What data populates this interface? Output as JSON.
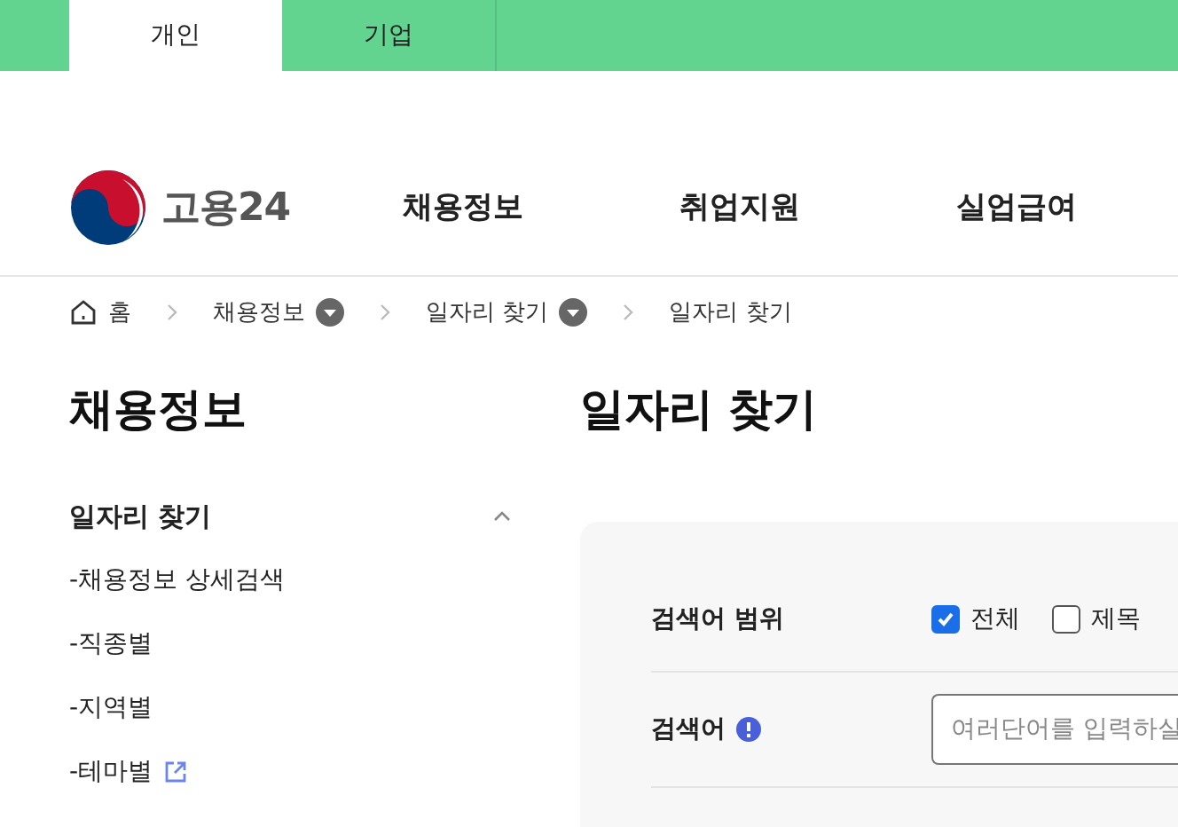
{
  "top_tabs": [
    {
      "label": "개인",
      "selected": true
    },
    {
      "label": "기업",
      "selected": false
    }
  ],
  "logo": {
    "text": "고용24"
  },
  "nav": [
    "채용정보",
    "취업지원",
    "실업급여"
  ],
  "breadcrumb": [
    {
      "label": "홈",
      "kind": "home"
    },
    {
      "label": "채용정보",
      "kind": "dropdown"
    },
    {
      "label": "일자리 찾기",
      "kind": "dropdown"
    },
    {
      "label": "일자리 찾기",
      "kind": "current"
    }
  ],
  "sidebar": {
    "title": "채용정보",
    "section": {
      "label": "일자리 찾기",
      "expanded": true,
      "children": [
        {
          "label": "-채용정보 상세검색",
          "external": false
        },
        {
          "label": "-직종별",
          "external": false
        },
        {
          "label": "-지역별",
          "external": false
        },
        {
          "label": "-테마별",
          "external": true
        }
      ]
    }
  },
  "page_title": "일자리 찾기",
  "search_form": {
    "rows": [
      {
        "kind": "checkboxes",
        "label": "검색어 범위",
        "info": false,
        "options": [
          {
            "label": "전체",
            "checked": true
          },
          {
            "label": "제목",
            "checked": false
          }
        ]
      },
      {
        "kind": "input",
        "label": "검색어",
        "info": true,
        "placeholder": "여러단어를 입력하실"
      }
    ]
  }
}
